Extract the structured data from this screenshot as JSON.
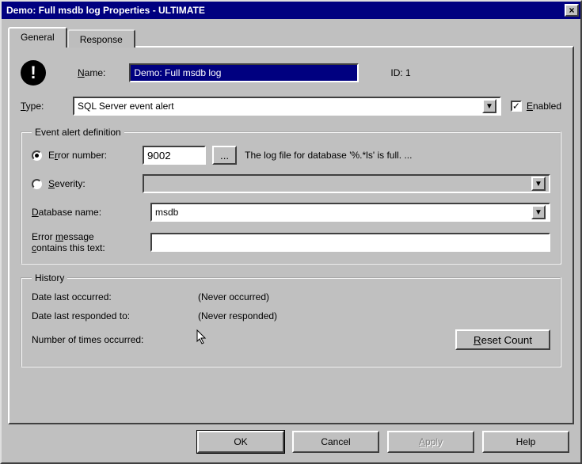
{
  "titlebar": {
    "title": "Demo: Full msdb log Properties - ULTIMATE",
    "close_icon": "×"
  },
  "tabs": {
    "general": "General",
    "response": "Response"
  },
  "name_section": {
    "icon_glyph": "!",
    "name_label_pre": "",
    "name_label_u": "N",
    "name_label_post": "ame:",
    "name_value": "Demo: Full msdb log",
    "id_label": "ID: 1"
  },
  "type_section": {
    "type_label_u": "T",
    "type_label_post": "ype:",
    "type_value": "SQL Server event alert",
    "enabled_u": "E",
    "enabled_post": "nabled",
    "enabled_checked": "✓"
  },
  "event_def": {
    "legend": "Event alert definition",
    "errnum_label_pre": "E",
    "errnum_label_u": "r",
    "errnum_label_post": "ror number:",
    "errnum_value": "9002",
    "browse_label": "...",
    "errnum_desc": "The log file for database '%.*ls' is full. ...",
    "severity_label_u": "S",
    "severity_label_post": "everity:",
    "severity_value": "",
    "dbname_label_u": "D",
    "dbname_label_post": "atabase name:",
    "dbname_value": "msdb",
    "errmsg_label_line1_pre": "Error ",
    "errmsg_label_u": "m",
    "errmsg_label_line1_post": "essage",
    "errmsg_label_line2_pre": "",
    "errmsg_label_line2_u": "c",
    "errmsg_label_line2_post": "ontains this text:",
    "errmsg_value": ""
  },
  "history": {
    "legend": "History",
    "date_occurred_label": "Date last occurred:",
    "date_occurred_value": "(Never occurred)",
    "date_responded_label": "Date last responded to:",
    "date_responded_value": "(Never responded)",
    "times_label": "Number of times occurred:",
    "times_value": "",
    "reset_u": "R",
    "reset_post": "eset Count"
  },
  "buttons": {
    "ok": "OK",
    "cancel": "Cancel",
    "apply_u": "A",
    "apply_post": "pply",
    "help": "Help"
  }
}
